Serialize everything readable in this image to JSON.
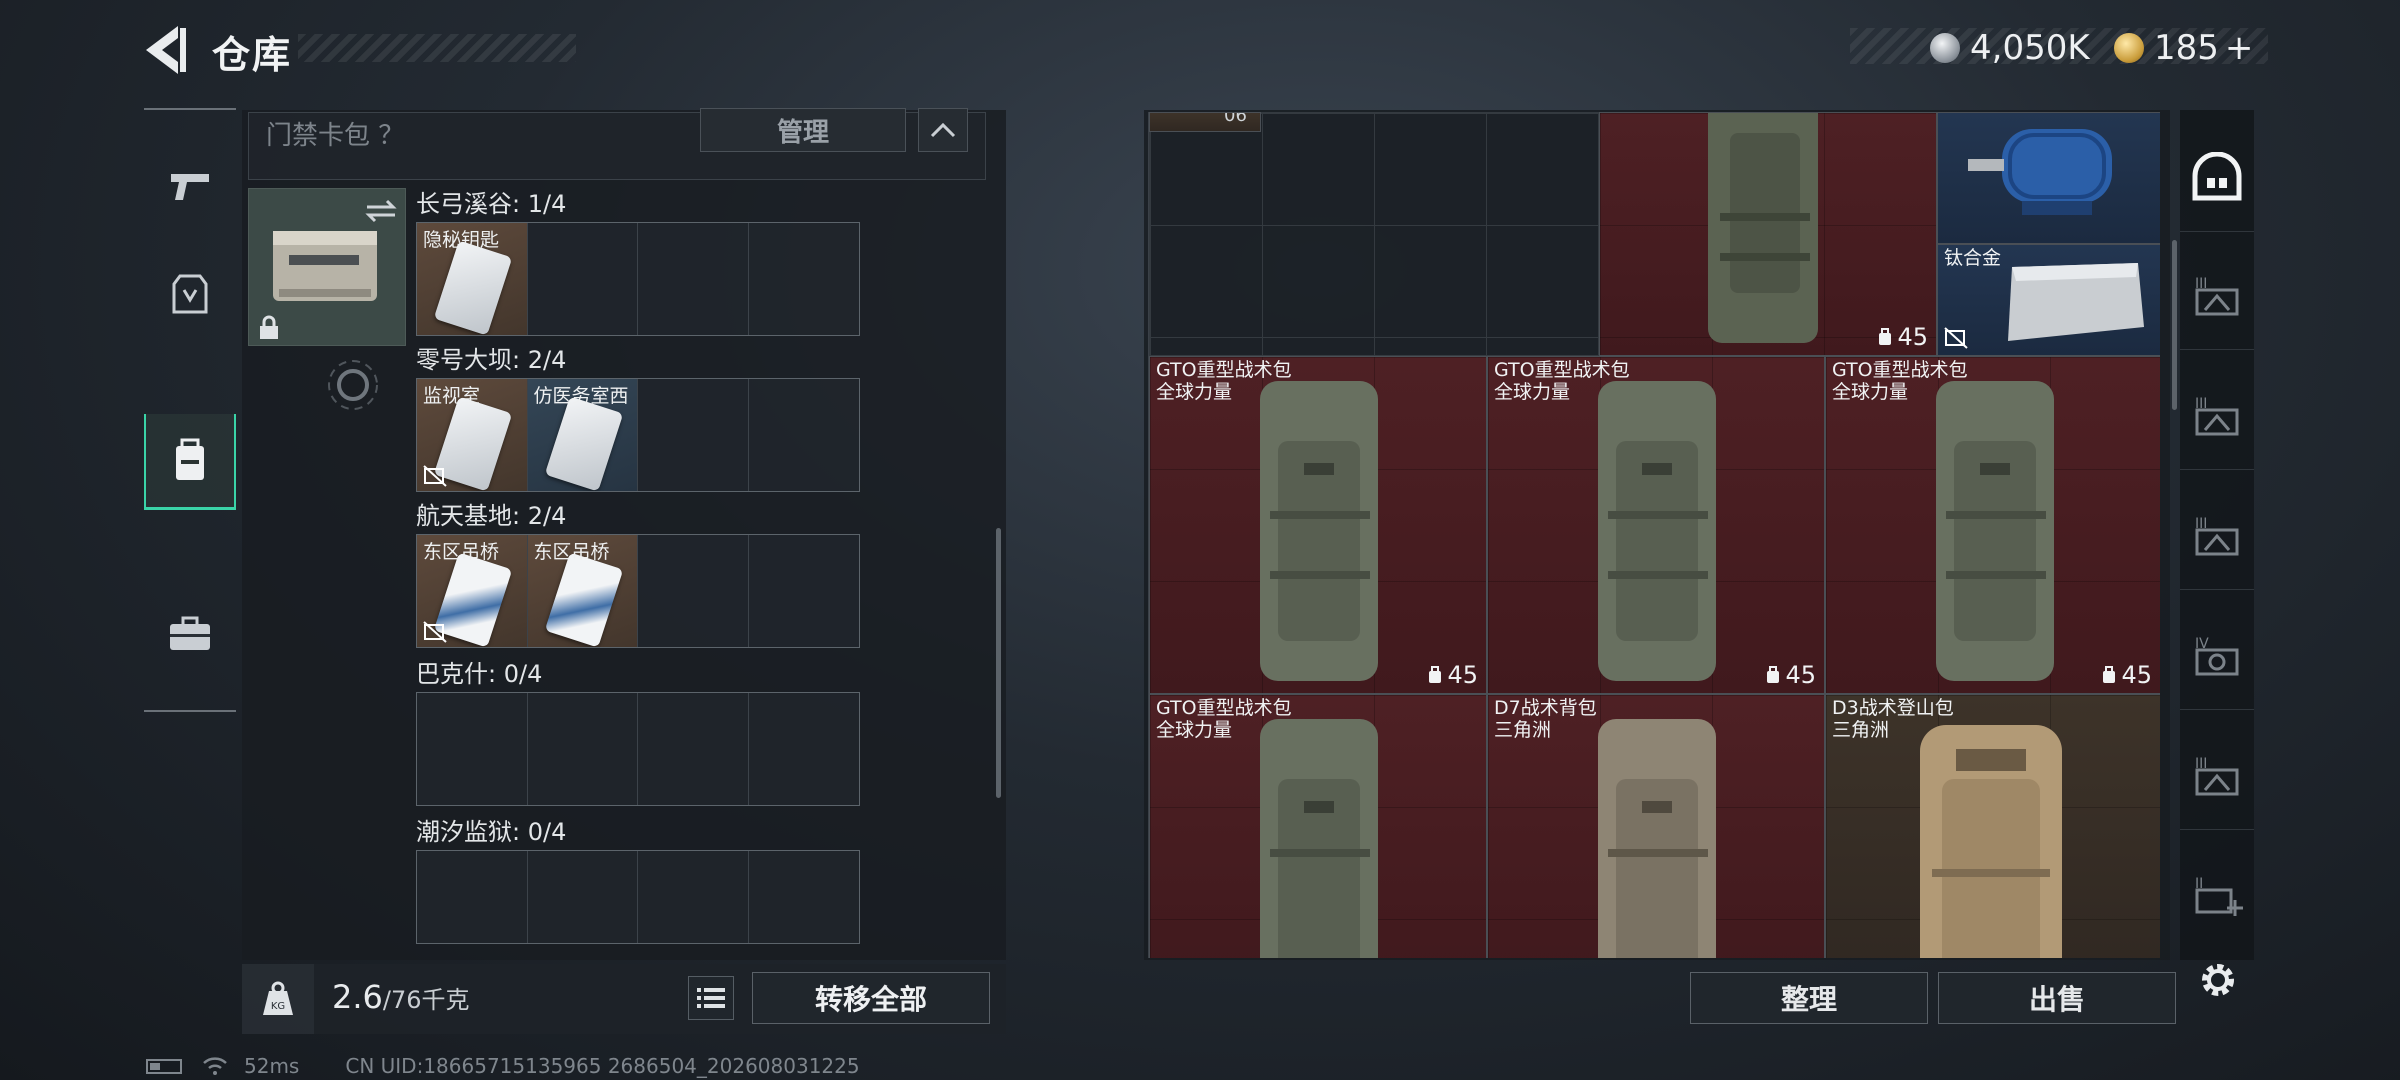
{
  "header": {
    "title": "仓库",
    "currency_silver": "4,050K",
    "currency_gold": "185",
    "add_label": "+"
  },
  "keycard_section": {
    "title": "门禁卡包 ？",
    "manage_label": "管理"
  },
  "regions": [
    {
      "label": "长弓溪谷: 1/4",
      "slots": [
        {
          "name": "隐秘钥匙",
          "color": "brown",
          "no_card": false
        }
      ]
    },
    {
      "label": "零号大坝: 2/4",
      "slots": [
        {
          "name": "监视室",
          "color": "brown",
          "no_card": true
        },
        {
          "name": "仿医务室西",
          "color": "blue",
          "no_card": false
        }
      ]
    },
    {
      "label": "航天基地: 2/4",
      "slots": [
        {
          "name": "东区吊桥",
          "color": "brown",
          "no_card": true
        },
        {
          "name": "东区吊桥",
          "color": "brown",
          "no_card": false
        }
      ]
    },
    {
      "label": "巴克什: 0/4",
      "slots": []
    },
    {
      "label": "潮汐监狱: 0/4",
      "slots": []
    }
  ],
  "weight": {
    "current": "2.6",
    "max": "/76千克"
  },
  "buttons": {
    "transfer_all": "转移全部",
    "sort": "整理",
    "sell": "出售"
  },
  "stash_items": [
    {
      "id": "top-stub",
      "name": "",
      "qty": "",
      "color": "brown",
      "partial_label": "06"
    },
    {
      "id": "top-backpack",
      "name": "",
      "qty": "45",
      "color": "red"
    },
    {
      "id": "motor",
      "name": "",
      "qty": "",
      "color": "blue"
    },
    {
      "id": "titanium",
      "name": "钛合金",
      "qty": "",
      "color": "blue"
    },
    {
      "id": "bp1",
      "name": "GTO重型战术包",
      "sub": "全球力量",
      "qty": "45",
      "color": "red",
      "tone": "green"
    },
    {
      "id": "bp2",
      "name": "GTO重型战术包",
      "sub": "全球力量",
      "qty": "45",
      "color": "red",
      "tone": "green"
    },
    {
      "id": "bp3",
      "name": "GTO重型战术包",
      "sub": "全球力量",
      "qty": "45",
      "color": "red",
      "tone": "green"
    },
    {
      "id": "bp4",
      "name": "GTO重型战术包",
      "sub": "全球力量",
      "qty": "",
      "color": "red",
      "tone": "green"
    },
    {
      "id": "bp5",
      "name": "D7战术背包",
      "sub": "三角洲",
      "qty": "",
      "color": "red",
      "tone": "tan"
    },
    {
      "id": "bp6",
      "name": "D3战术登山包",
      "sub": "三角洲",
      "qty": "",
      "color": "brown",
      "tone": "sand"
    }
  ],
  "right_column": [
    "III",
    "III",
    "III",
    "IV",
    "III",
    "II"
  ],
  "status_bar": {
    "ping": "52ms",
    "uid": "CN UID:18665715135965 2686504_202608031225"
  }
}
